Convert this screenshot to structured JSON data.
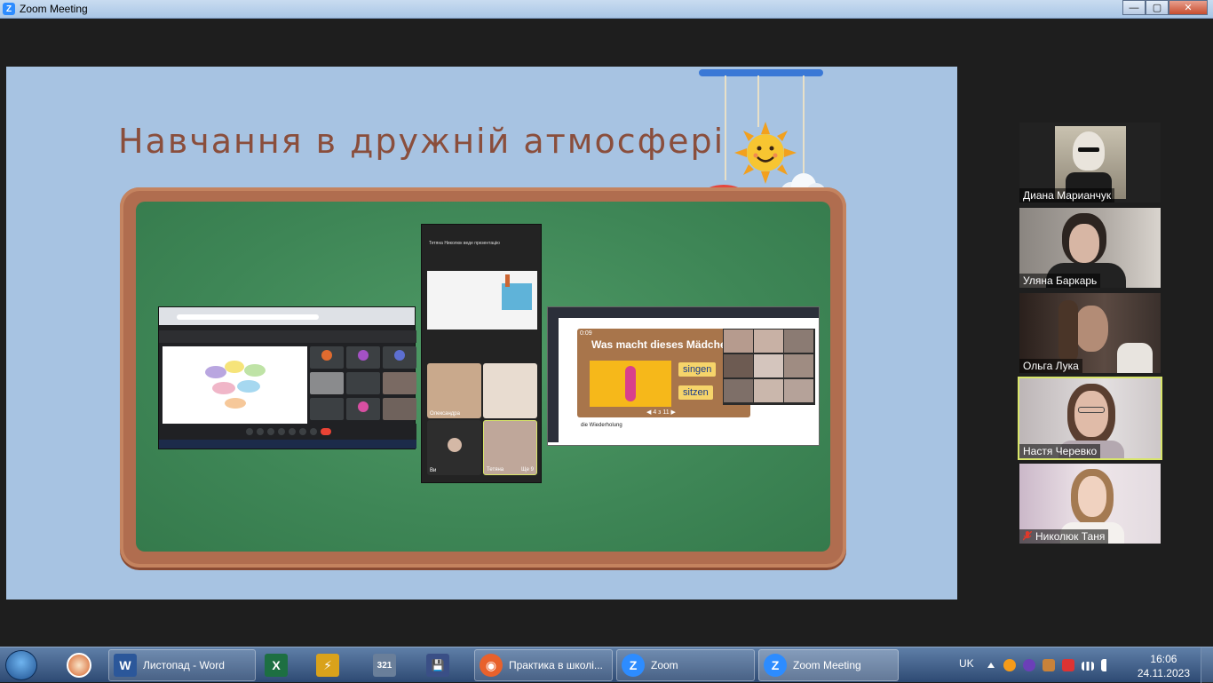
{
  "window": {
    "title": "Zoom Meeting",
    "controls": {
      "minimize": "—",
      "maximize": "▢",
      "close": "✕"
    }
  },
  "slide": {
    "title": "Навчання в дружній атмосфері",
    "shot2_header": "Тетяна Николюк веде презентацію",
    "shot2_labels": {
      "tile1": "Олександра",
      "tile3": "Ви",
      "tile4": "Тетяна",
      "more": "Ще 9"
    },
    "shot3_question": "Was macht dieses Mädchen?",
    "shot3_answers": [
      "singen",
      "sitzen"
    ],
    "shot3_counter": "◀ 4 з 11 ▶",
    "shot3_timer": "0:09",
    "shot3_footer": "die Wiederholung"
  },
  "participants": [
    {
      "name": "Диана Марианчук",
      "muted": false,
      "active": false,
      "bg": "#222222"
    },
    {
      "name": "Уляна Баркарь",
      "muted": false,
      "active": false,
      "bg": "#6f6a66"
    },
    {
      "name": "Ольга Лука",
      "muted": false,
      "active": false,
      "bg": "#3a302c"
    },
    {
      "name": "Настя Черевко",
      "muted": false,
      "active": true,
      "bg": "#c9c2c3"
    },
    {
      "name": "Николюк Таня",
      "muted": true,
      "active": false,
      "bg": "#d9cfd4"
    }
  ],
  "taskbar": {
    "items": [
      {
        "label": "Листопад - Word",
        "icon": "word-icon",
        "color": "#2b579a",
        "glyph": "W"
      },
      {
        "label": "",
        "icon": "excel-icon",
        "color": "#1d6f42",
        "glyph": "X"
      },
      {
        "label": "",
        "icon": "bolt-app-icon",
        "color": "#d9a21b",
        "glyph": "⚡"
      },
      {
        "label": "",
        "icon": "media-player-icon",
        "color": "#6a7f9a",
        "glyph": "321"
      },
      {
        "label": "",
        "icon": "floppy-icon",
        "color": "#3a4f86",
        "glyph": "💾"
      },
      {
        "label": "Практика в школі...",
        "icon": "firefox-icon",
        "color": "#e8612c",
        "glyph": "◉"
      },
      {
        "label": "Zoom",
        "icon": "zoom-icon",
        "color": "#2d8cff",
        "glyph": "Z"
      },
      {
        "label": "Zoom Meeting",
        "icon": "zoom-icon",
        "color": "#2d8cff",
        "glyph": "Z"
      }
    ],
    "language": "UK",
    "time": "16:06",
    "date": "24.11.2023"
  }
}
